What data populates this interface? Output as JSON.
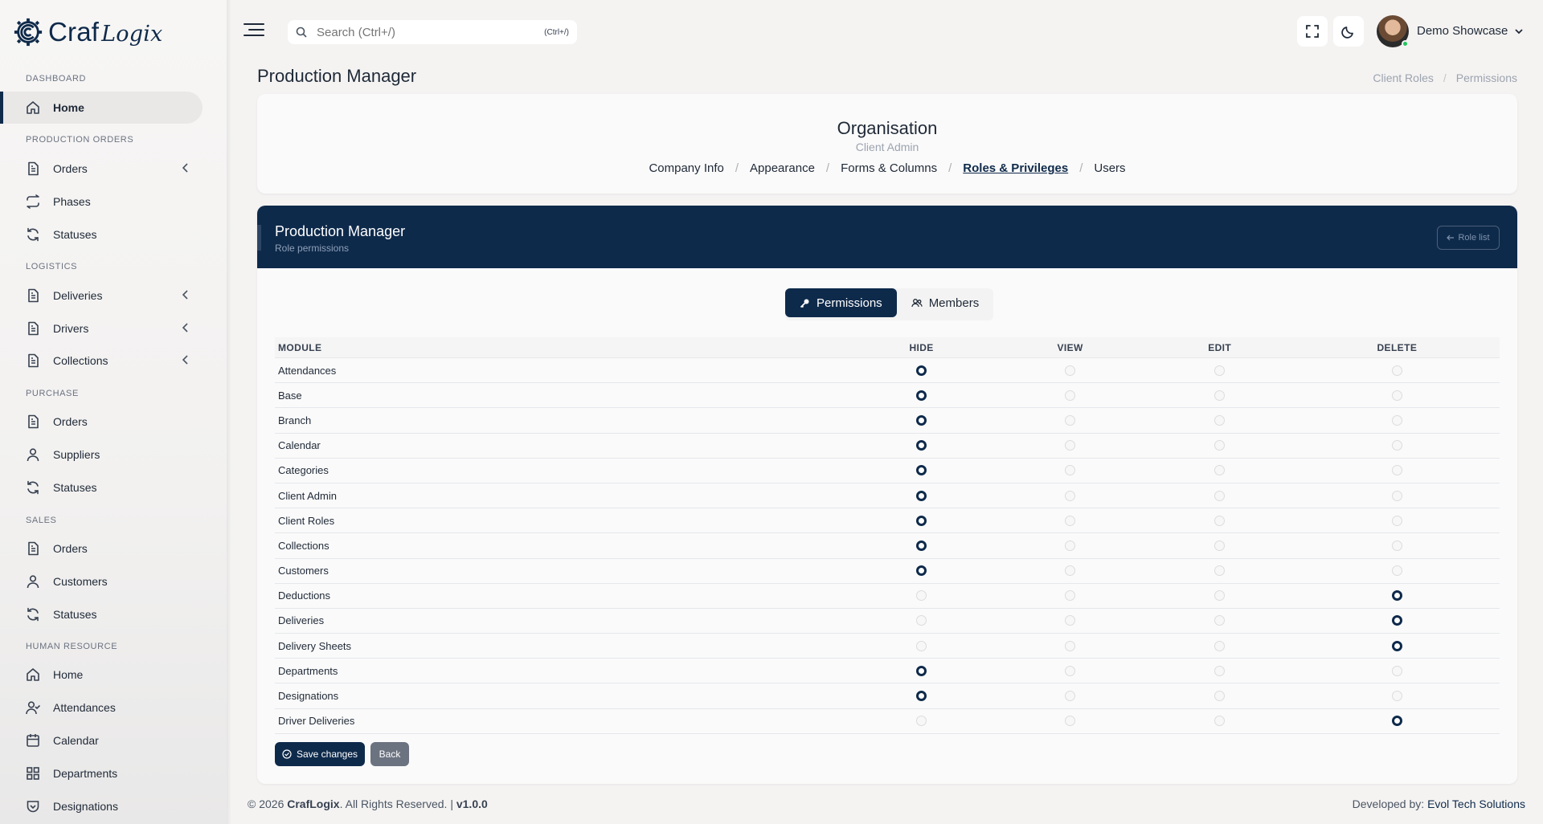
{
  "brand": {
    "name_part1": "Craf",
    "name_part2": "Logix"
  },
  "sidebar": {
    "sections": [
      {
        "label": "DASHBOARD"
      },
      {
        "label": "PRODUCTION ORDERS"
      },
      {
        "label": "LOGISTICS"
      },
      {
        "label": "PURCHASE"
      },
      {
        "label": "SALES"
      },
      {
        "label": "HUMAN RESOURCE"
      }
    ],
    "items": [
      {
        "label": "Home",
        "icon": "home-icon",
        "active": true
      },
      {
        "label": "Orders",
        "icon": "document-icon",
        "chevron": true
      },
      {
        "label": "Phases",
        "icon": "repeat-icon"
      },
      {
        "label": "Statuses",
        "icon": "refresh-icon"
      },
      {
        "label": "Deliveries",
        "icon": "document-icon",
        "chevron": true
      },
      {
        "label": "Drivers",
        "icon": "document-icon",
        "chevron": true
      },
      {
        "label": "Collections",
        "icon": "document-icon",
        "chevron": true
      },
      {
        "label": "Orders",
        "icon": "document-icon"
      },
      {
        "label": "Suppliers",
        "icon": "user-icon"
      },
      {
        "label": "Statuses",
        "icon": "refresh-icon"
      },
      {
        "label": "Orders",
        "icon": "document-icon"
      },
      {
        "label": "Customers",
        "icon": "user-icon"
      },
      {
        "label": "Statuses",
        "icon": "refresh-icon"
      },
      {
        "label": "Home",
        "icon": "home-icon"
      },
      {
        "label": "Attendances",
        "icon": "user-check-icon"
      },
      {
        "label": "Calendar",
        "icon": "calendar-icon"
      },
      {
        "label": "Departments",
        "icon": "grid-icon"
      },
      {
        "label": "Designations",
        "icon": "badge-icon"
      }
    ]
  },
  "topbar": {
    "search_placeholder": "Search (Ctrl+/)",
    "search_shortcut": "(Ctrl+/)",
    "user_name": "Demo Showcase"
  },
  "page": {
    "title": "Production Manager",
    "breadcrumb": [
      "Client Roles",
      "Permissions"
    ]
  },
  "org": {
    "title": "Organisation",
    "subtitle": "Client Admin",
    "tabs": [
      "Company Info",
      "Appearance",
      "Forms & Columns",
      "Roles & Privileges",
      "Users"
    ],
    "active_tab": "Roles & Privileges"
  },
  "role": {
    "title": "Production Manager",
    "subtitle": "Role permissions",
    "role_list_label": "Role list",
    "tabs": [
      "Permissions",
      "Members"
    ],
    "active_tab": "Permissions"
  },
  "table": {
    "headers": [
      "MODULE",
      "HIDE",
      "VIEW",
      "EDIT",
      "DELETE"
    ],
    "rows": [
      {
        "module": "Attendances",
        "selected": "HIDE"
      },
      {
        "module": "Base",
        "selected": "HIDE"
      },
      {
        "module": "Branch",
        "selected": "HIDE"
      },
      {
        "module": "Calendar",
        "selected": "HIDE"
      },
      {
        "module": "Categories",
        "selected": "HIDE"
      },
      {
        "module": "Client Admin",
        "selected": "HIDE"
      },
      {
        "module": "Client Roles",
        "selected": "HIDE"
      },
      {
        "module": "Collections",
        "selected": "HIDE"
      },
      {
        "module": "Customers",
        "selected": "HIDE"
      },
      {
        "module": "Deductions",
        "selected": "DELETE"
      },
      {
        "module": "Deliveries",
        "selected": "DELETE"
      },
      {
        "module": "Delivery Sheets",
        "selected": "DELETE"
      },
      {
        "module": "Departments",
        "selected": "HIDE"
      },
      {
        "module": "Designations",
        "selected": "HIDE"
      },
      {
        "module": "Driver Deliveries",
        "selected": "DELETE"
      }
    ]
  },
  "actions": {
    "save": "Save changes",
    "back": "Back"
  },
  "footer": {
    "copyright_prefix": "© 2026",
    "company": "CrafLogix",
    "rights": ". All Rights Reserved. |",
    "version": "v1.0.0",
    "dev_label": "Developed by:",
    "dev_name": "Evol Tech Solutions"
  },
  "colors": {
    "primary": "#0e2a4b",
    "background": "#f4f3f2",
    "online": "#22c55e"
  }
}
